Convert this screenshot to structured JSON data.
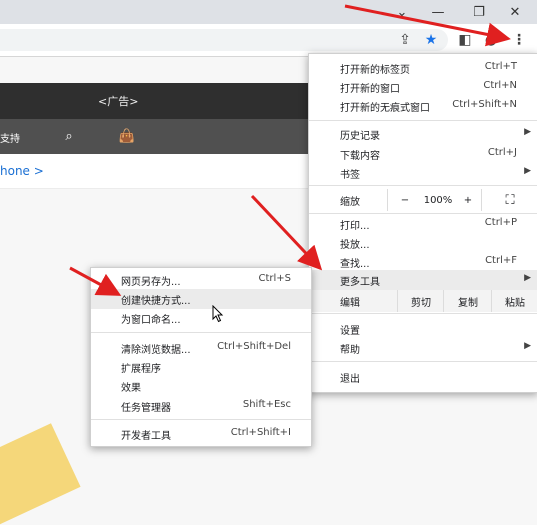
{
  "page": {
    "ad_label": "<广告>",
    "nav_support": "支持",
    "link_text": "hone >"
  },
  "main_menu": {
    "new_tab": {
      "label": "打开新的标签页",
      "shortcut": "Ctrl+T"
    },
    "new_window": {
      "label": "打开新的窗口",
      "shortcut": "Ctrl+N"
    },
    "new_incognito": {
      "label": "打开新的无痕式窗口",
      "shortcut": "Ctrl+Shift+N"
    },
    "history": {
      "label": "历史记录"
    },
    "downloads": {
      "label": "下载内容",
      "shortcut": "Ctrl+J"
    },
    "bookmarks": {
      "label": "书签"
    },
    "zoom": {
      "label": "缩放",
      "minus": "−",
      "value": "100%",
      "plus": "+"
    },
    "print": {
      "label": "打印...",
      "shortcut": "Ctrl+P"
    },
    "cast": {
      "label": "投放..."
    },
    "find": {
      "label": "查找...",
      "shortcut": "Ctrl+F"
    },
    "more_tools": {
      "label": "更多工具"
    },
    "edit": {
      "label": "编辑",
      "cut": "剪切",
      "copy": "复制",
      "paste": "粘贴"
    },
    "settings": {
      "label": "设置"
    },
    "help": {
      "label": "帮助"
    },
    "exit": {
      "label": "退出"
    }
  },
  "sub_menu": {
    "save_as": {
      "label": "网页另存为...",
      "shortcut": "Ctrl+S"
    },
    "create_shortcut": {
      "label": "创建快捷方式..."
    },
    "name_window": {
      "label": "为窗口命名..."
    },
    "clear_data": {
      "label": "清除浏览数据...",
      "shortcut": "Ctrl+Shift+Del"
    },
    "extensions": {
      "label": "扩展程序"
    },
    "effects": {
      "label": "效果"
    },
    "task_manager": {
      "label": "任务管理器",
      "shortcut": "Shift+Esc"
    },
    "dev_tools": {
      "label": "开发者工具",
      "shortcut": "Ctrl+Shift+I"
    }
  },
  "colors": {
    "accent_blue": "#1a73e8",
    "annotation_red": "#e02020",
    "highlight": "#ebebeb"
  }
}
